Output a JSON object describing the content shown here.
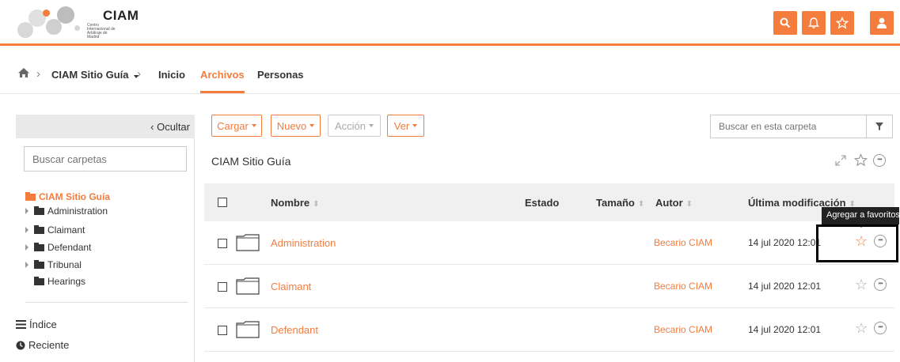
{
  "header": {
    "logo_title": "CIAM",
    "logo_subtitle": "Centro Internacional de Arbitraje de Madrid",
    "buttons": [
      "search-icon",
      "bell-icon",
      "star-icon",
      "user-icon"
    ],
    "accent_color": "#f47c3c"
  },
  "breadcrumb": {
    "home_icon": "home-icon",
    "site": "CIAM Sitio Guía",
    "links": [
      "Inicio",
      "Archivos",
      "Personas"
    ],
    "active": "Archivos"
  },
  "sidebar": {
    "hide_label": "Ocultar",
    "search_placeholder": "Buscar carpetas",
    "tree_root": "CIAM Sitio Guía",
    "tree_items": [
      "Administration",
      "Claimant",
      "Defendant",
      "Tribunal",
      "Hearings"
    ],
    "links": [
      "Índice",
      "Reciente"
    ]
  },
  "toolbar": {
    "upload": "Cargar",
    "new": "Nuevo",
    "action": "Acción",
    "view": "Ver",
    "search_placeholder": "Buscar en esta carpeta"
  },
  "folder_title": "CIAM Sitio Guía",
  "table": {
    "columns": [
      "Nombre",
      "Estado",
      "Tamaño",
      "Autor",
      "Última modificación"
    ],
    "rows": [
      {
        "name": "Administration",
        "author": "Becario CIAM",
        "date": "14 jul 2020 12:01"
      },
      {
        "name": "Claimant",
        "author": "Becario CIAM",
        "date": "14 jul 2020 12:01"
      },
      {
        "name": "Defendant",
        "author": "Becario CIAM",
        "date": "14 jul 2020 12:01"
      }
    ]
  },
  "tooltip": "Agregar a favoritos"
}
